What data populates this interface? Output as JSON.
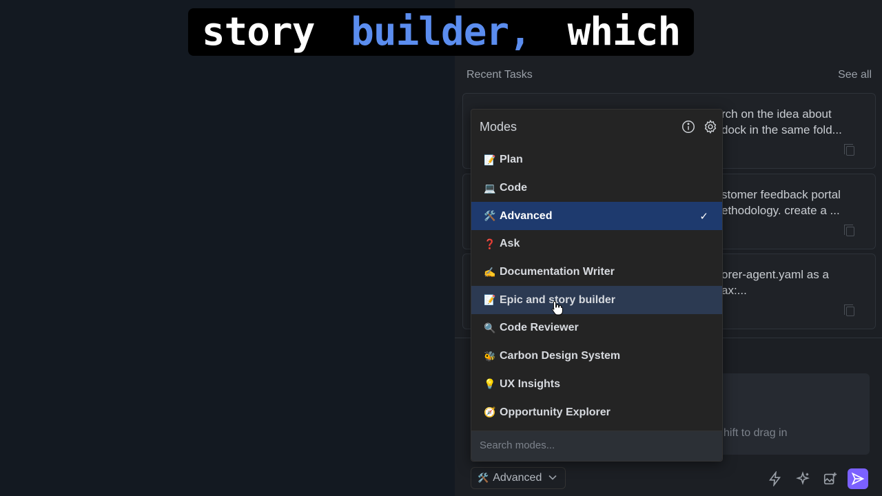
{
  "caption": {
    "part1": "story",
    "part2": "builder,",
    "part3": "which"
  },
  "recent_tasks": {
    "title": "Recent Tasks",
    "see_all": "See all",
    "cards": [
      {
        "text": "rch on the idea about\ndock in the same fold..."
      },
      {
        "text": "stomer feedback portal\nethodology. create a ..."
      },
      {
        "text": "orer-agent.yaml as a\nax:..."
      }
    ]
  },
  "chat_input": {
    "placeholder_fragment": "hift to drag in"
  },
  "modes": {
    "title": "Modes",
    "items": [
      {
        "emoji": "📝",
        "label": "Plan"
      },
      {
        "emoji": "💻",
        "label": "Code"
      },
      {
        "emoji": "🛠️",
        "label": "Advanced"
      },
      {
        "emoji": "❓",
        "label": "Ask"
      },
      {
        "emoji": "✍️",
        "label": "Documentation Writer"
      },
      {
        "emoji": "📝",
        "label": "Epic and story builder"
      },
      {
        "emoji": "🔍",
        "label": "Code Reviewer"
      },
      {
        "emoji": "🐝",
        "label": "Carbon Design System"
      },
      {
        "emoji": "💡",
        "label": "UX Insights"
      },
      {
        "emoji": "🧭",
        "label": "Opportunity Explorer"
      }
    ],
    "selected_check": "✓",
    "search_placeholder": "Search modes..."
  },
  "mode_selector": {
    "emoji": "🛠️",
    "label": "Advanced",
    "chevron": "⌄"
  },
  "colors": {
    "accent_selected": "#1e3a6e",
    "hover_row": "#2c3a52",
    "send_button": "#7b61ff",
    "caption_highlight": "#5b8def"
  }
}
